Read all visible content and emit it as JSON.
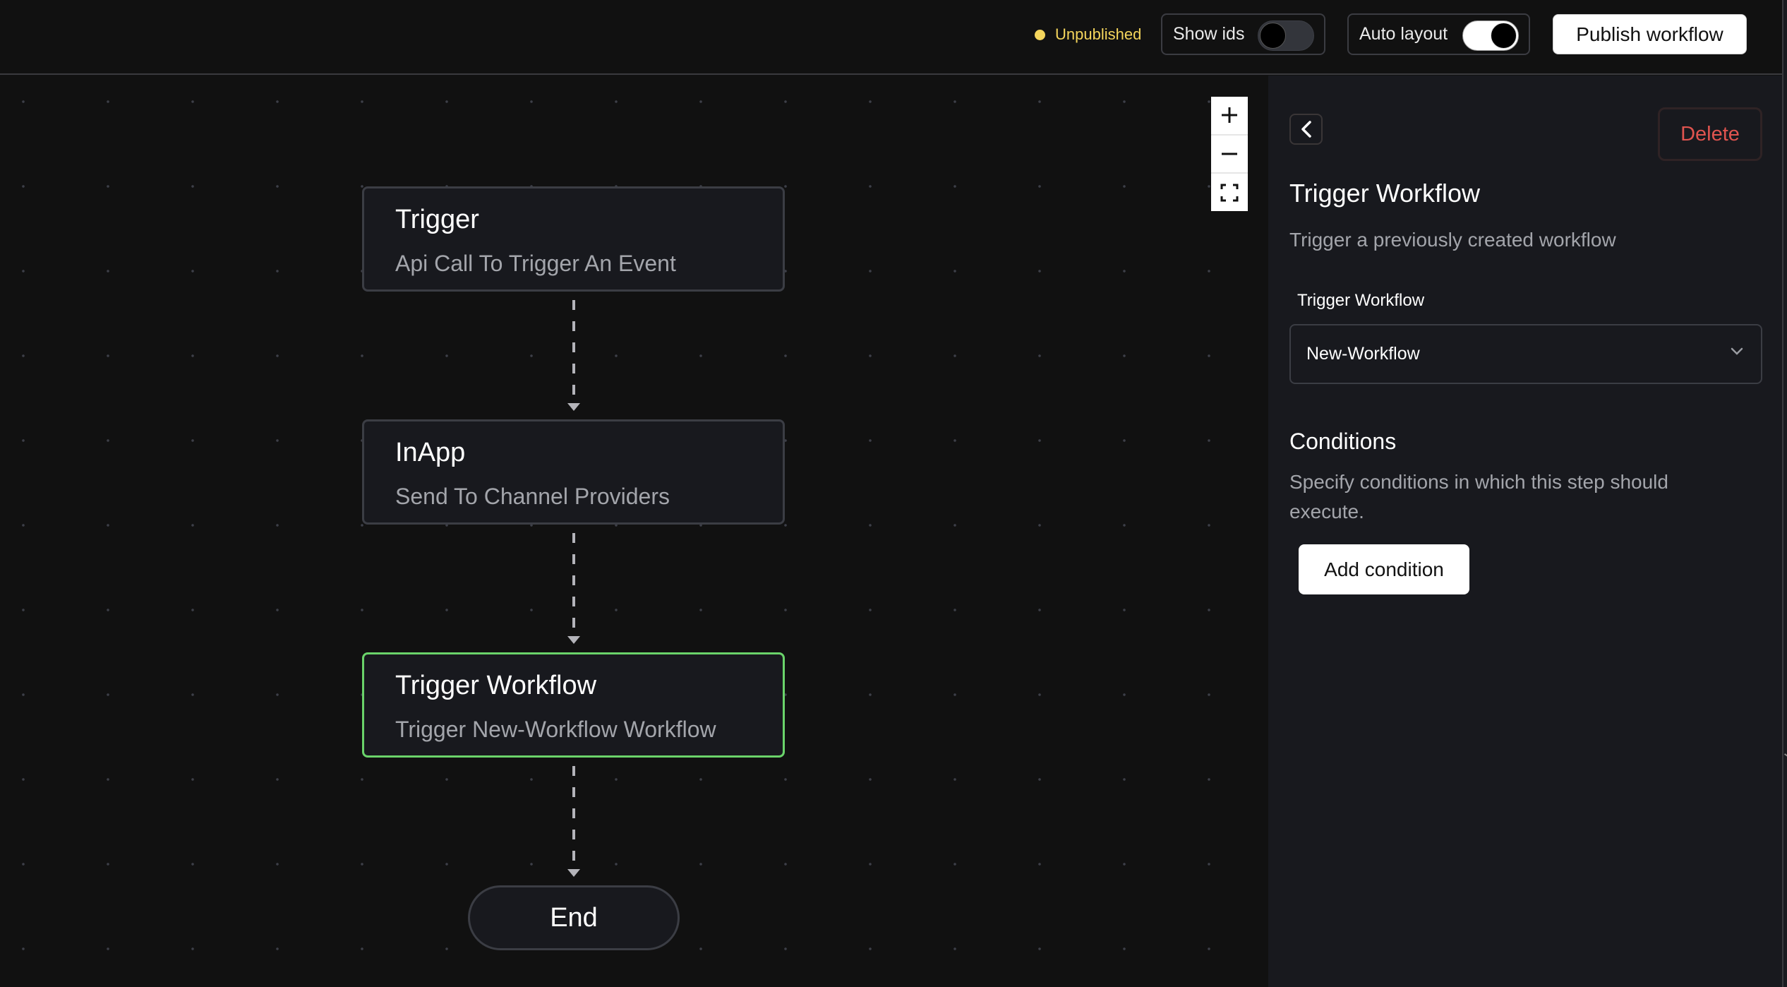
{
  "header": {
    "status_label": "Unpublished",
    "status_color": "#f4d55c",
    "show_ids": {
      "label": "Show ids",
      "on": false
    },
    "auto_layout": {
      "label": "Auto layout",
      "on": true
    },
    "publish_label": "Publish workflow"
  },
  "canvas": {
    "zoom_controls": {
      "zoom_in_icon": "plus-icon",
      "zoom_out_icon": "minus-icon",
      "fit_view_icon": "fit-view-icon"
    },
    "nodes": [
      {
        "title": "Trigger",
        "subtitle": "Api Call To Trigger An Event",
        "selected": false
      },
      {
        "title": "InApp",
        "subtitle": "Send To Channel Providers",
        "selected": false
      },
      {
        "title": "Trigger Workflow",
        "subtitle": "Trigger New-Workflow Workflow",
        "selected": true
      }
    ],
    "end_label": "End",
    "selected_color": "#6ad36a"
  },
  "panel": {
    "back_icon": "chevron-left-icon",
    "delete_label": "Delete",
    "delete_color": "#e0544f",
    "title": "Trigger Workflow",
    "description": "Trigger a previously created workflow",
    "field_label": "Trigger Workflow",
    "select_value": "New-Workflow",
    "conditions_title": "Conditions",
    "conditions_desc": "Specify conditions in which this step should execute.",
    "add_condition_label": "Add condition"
  }
}
